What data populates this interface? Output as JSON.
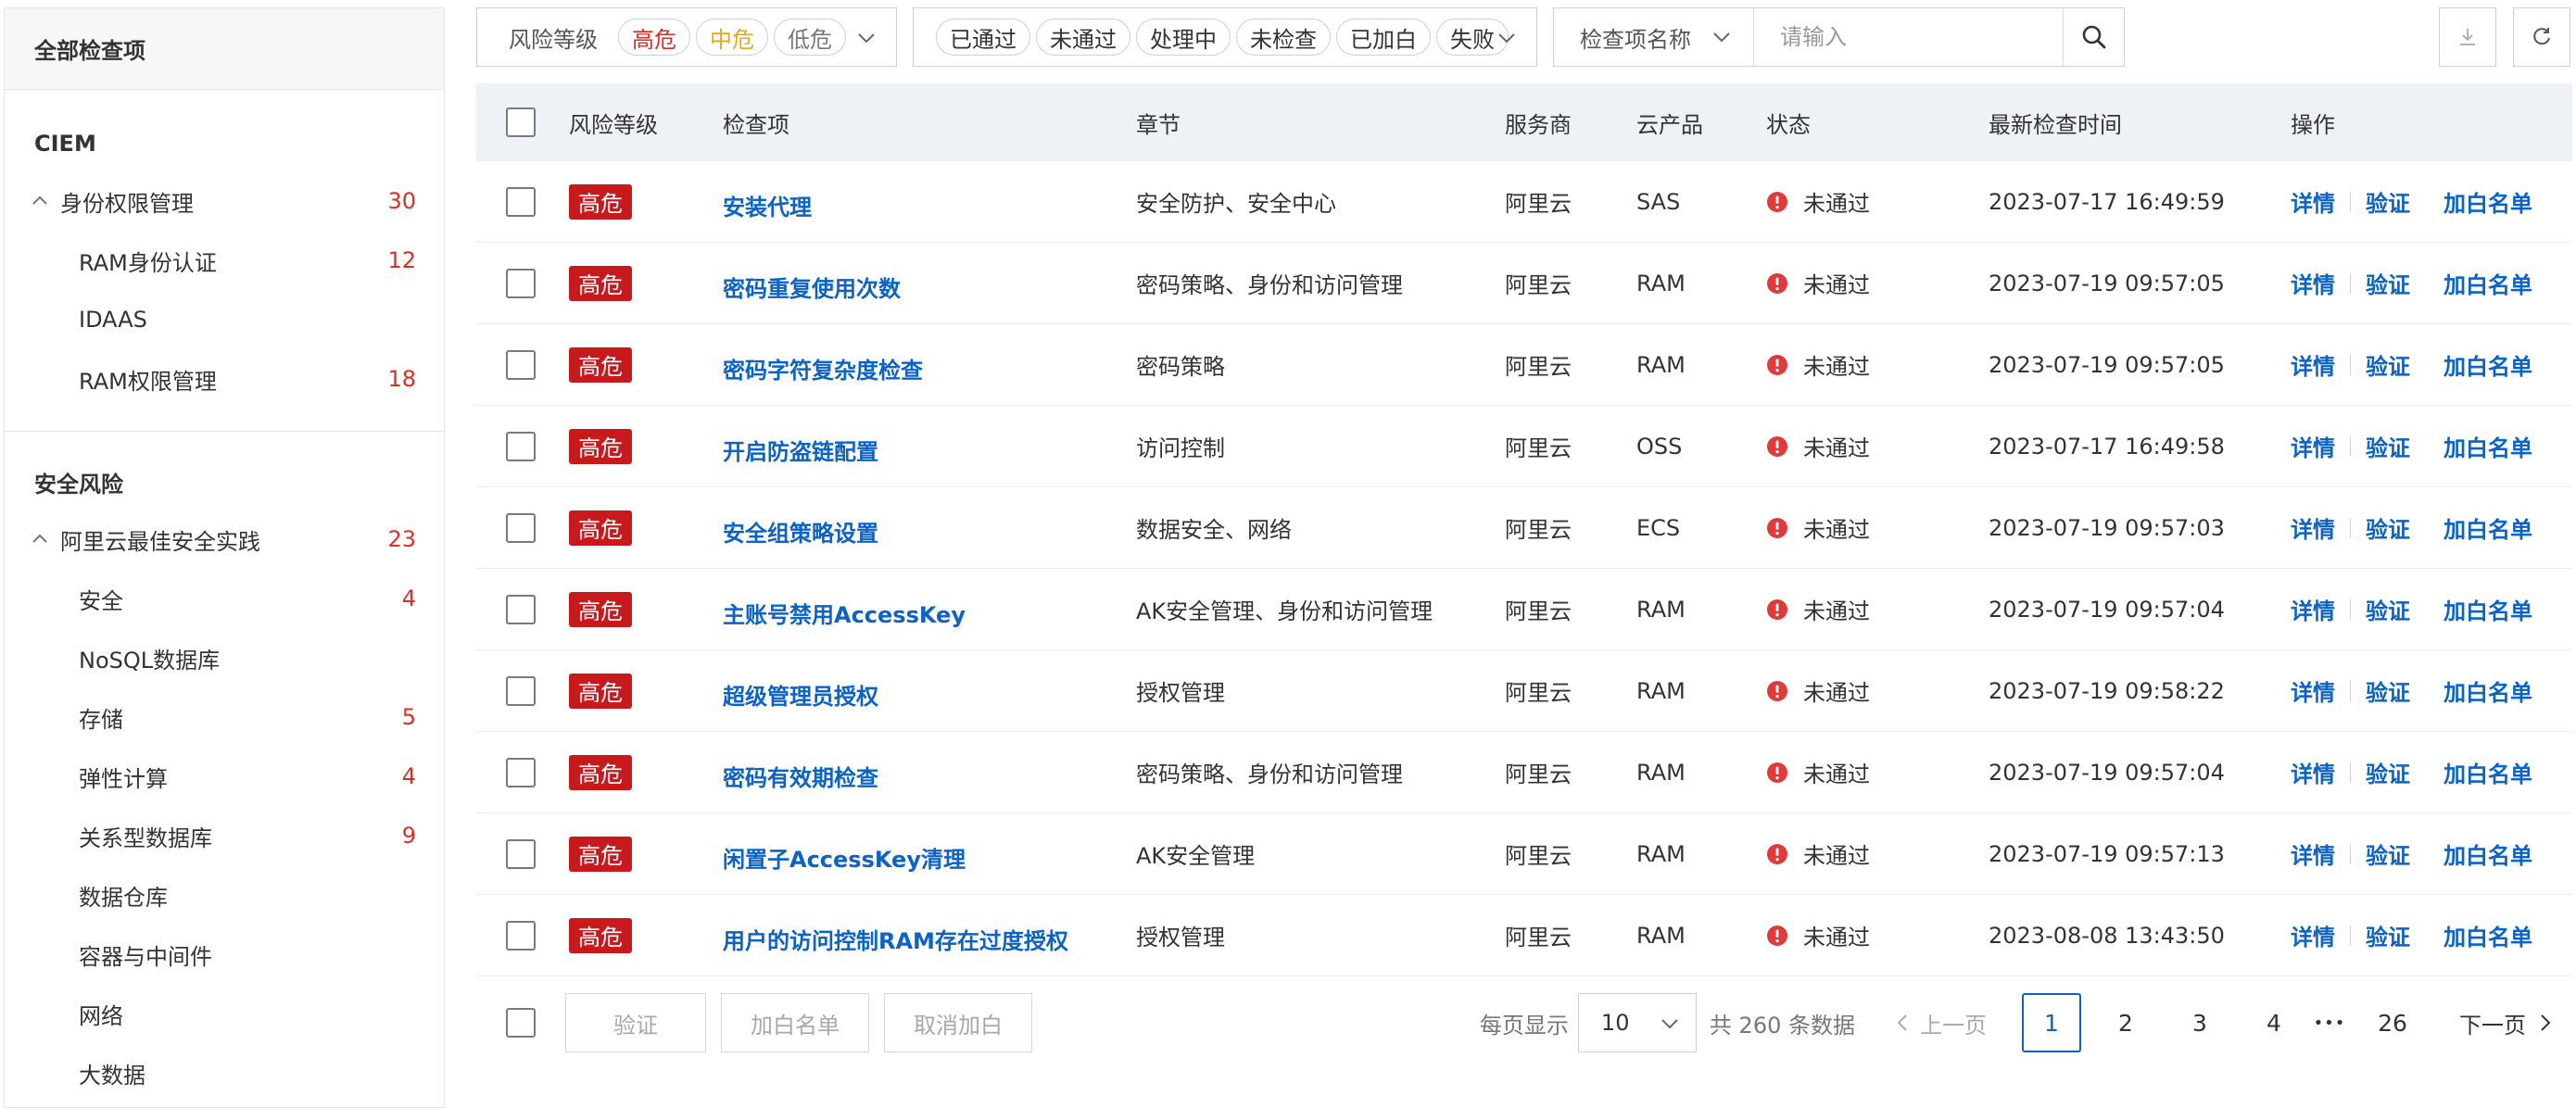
{
  "sidebar": {
    "header": "全部检查项",
    "sections": [
      {
        "title": "CIEM",
        "group": {
          "label": "身份权限管理",
          "count": "30"
        },
        "items": [
          {
            "label": "RAM身份认证",
            "count": "12"
          },
          {
            "label": "IDAAS",
            "count": ""
          },
          {
            "label": "RAM权限管理",
            "count": "18"
          }
        ]
      },
      {
        "title": "安全风险",
        "group": {
          "label": "阿里云最佳安全实践",
          "count": "23"
        },
        "items": [
          {
            "label": "安全",
            "count": "4"
          },
          {
            "label": "NoSQL数据库",
            "count": ""
          },
          {
            "label": "存储",
            "count": "5"
          },
          {
            "label": "弹性计算",
            "count": "4"
          },
          {
            "label": "关系型数据库",
            "count": "9"
          },
          {
            "label": "数据仓库",
            "count": ""
          },
          {
            "label": "容器与中间件",
            "count": ""
          },
          {
            "label": "网络",
            "count": ""
          },
          {
            "label": "大数据",
            "count": ""
          }
        ]
      }
    ]
  },
  "filters": {
    "risk_label": "风险等级",
    "risk_tags": [
      "高危",
      "中危",
      "低危"
    ],
    "status_tags": [
      "已通过",
      "未通过",
      "处理中",
      "未检查",
      "已加白",
      "失败"
    ],
    "search_field": "检查项名称",
    "search_placeholder": "请输入"
  },
  "table": {
    "headers": {
      "risk": "风险等级",
      "name": "检查项",
      "chapter": "章节",
      "provider": "服务商",
      "product": "云产品",
      "status": "状态",
      "time": "最新检查时间",
      "ops": "操作"
    },
    "ops_labels": {
      "detail": "详情",
      "verify": "验证",
      "whitelist": "加白名单"
    },
    "rows": [
      {
        "risk": "高危",
        "name": "安装代理",
        "chapter": "安全防护、安全中心",
        "provider": "阿里云",
        "product": "SAS",
        "status": "未通过",
        "time": "2023-07-17 16:49:59"
      },
      {
        "risk": "高危",
        "name": "密码重复使用次数",
        "chapter": "密码策略、身份和访问管理",
        "provider": "阿里云",
        "product": "RAM",
        "status": "未通过",
        "time": "2023-07-19 09:57:05"
      },
      {
        "risk": "高危",
        "name": "密码字符复杂度检查",
        "chapter": "密码策略",
        "provider": "阿里云",
        "product": "RAM",
        "status": "未通过",
        "time": "2023-07-19 09:57:05"
      },
      {
        "risk": "高危",
        "name": "开启防盗链配置",
        "chapter": "访问控制",
        "provider": "阿里云",
        "product": "OSS",
        "status": "未通过",
        "time": "2023-07-17 16:49:58"
      },
      {
        "risk": "高危",
        "name": "安全组策略设置",
        "chapter": "数据安全、网络",
        "provider": "阿里云",
        "product": "ECS",
        "status": "未通过",
        "time": "2023-07-19 09:57:03"
      },
      {
        "risk": "高危",
        "name": "主账号禁用AccessKey",
        "chapter": "AK安全管理、身份和访问管理",
        "provider": "阿里云",
        "product": "RAM",
        "status": "未通过",
        "time": "2023-07-19 09:57:04"
      },
      {
        "risk": "高危",
        "name": "超级管理员授权",
        "chapter": "授权管理",
        "provider": "阿里云",
        "product": "RAM",
        "status": "未通过",
        "time": "2023-07-19 09:58:22"
      },
      {
        "risk": "高危",
        "name": "密码有效期检查",
        "chapter": "密码策略、身份和访问管理",
        "provider": "阿里云",
        "product": "RAM",
        "status": "未通过",
        "time": "2023-07-19 09:57:04"
      },
      {
        "risk": "高危",
        "name": "闲置子AccessKey清理",
        "chapter": "AK安全管理",
        "provider": "阿里云",
        "product": "RAM",
        "status": "未通过",
        "time": "2023-07-19 09:57:13"
      },
      {
        "risk": "高危",
        "name": "用户的访问控制RAM存在过度授权",
        "chapter": "授权管理",
        "provider": "阿里云",
        "product": "RAM",
        "status": "未通过",
        "time": "2023-08-08 13:43:50"
      }
    ]
  },
  "footer": {
    "buttons": [
      "验证",
      "加白名单",
      "取消加白"
    ],
    "per_page_label": "每页显示",
    "per_page_value": "10",
    "total_text": "共 260 条数据",
    "prev_label": "上一页",
    "next_label": "下一页",
    "pages": [
      "1",
      "2",
      "3",
      "4",
      "26"
    ],
    "ellipsis": "•••",
    "current_page": "1"
  },
  "colors": {
    "high_risk": "#c8191c",
    "link": "#0b62c7",
    "count": "#d93026",
    "status_fail": "#e03a3a",
    "header_bg": "#eef1f5"
  },
  "icons": {
    "search": "search-icon",
    "download": "download-icon",
    "refresh": "refresh-icon",
    "status_fail": "exclamation-circle-icon"
  }
}
